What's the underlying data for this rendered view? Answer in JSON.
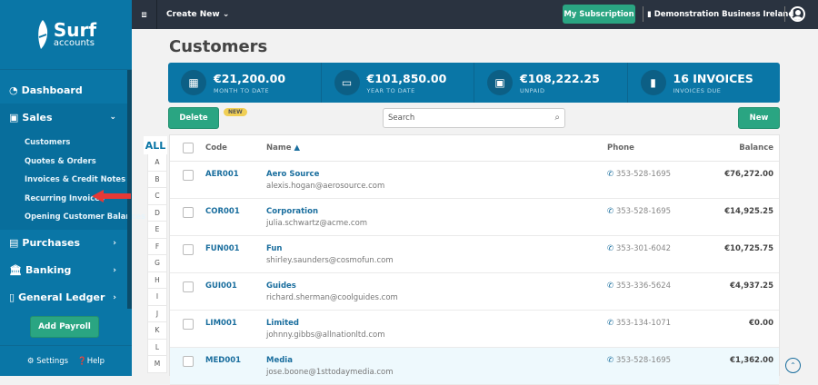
{
  "logo": {
    "word": "Surf",
    "sub": "accounts"
  },
  "sidebar": {
    "items": [
      {
        "label": "Dashboard",
        "icon": "dashboard-icon"
      },
      {
        "label": "Sales",
        "icon": "briefcase-icon",
        "expanded": true,
        "children": [
          "Customers",
          "Quotes & Orders",
          "Invoices & Credit Notes",
          "Recurring Invoices",
          "Opening Customer Balances"
        ]
      },
      {
        "label": "Purchases",
        "icon": "purchases-icon"
      },
      {
        "label": "Banking",
        "icon": "bank-icon"
      },
      {
        "label": "General Ledger",
        "icon": "ledger-icon"
      }
    ],
    "add_payroll": "Add Payroll",
    "settings": "Settings",
    "help": "Help"
  },
  "topbar": {
    "create_new": "Create New",
    "my_subscription": "My Subscription",
    "business": "Demonstration Business Ireland"
  },
  "page": {
    "title": "Customers"
  },
  "stats": [
    {
      "value": "€21,200.00",
      "label": "MONTH TO DATE"
    },
    {
      "value": "€101,850.00",
      "label": "YEAR TO DATE"
    },
    {
      "value": "€108,222.25",
      "label": "UNPAID"
    },
    {
      "value": "16 INVOICES",
      "label": "INVOICES DUE"
    }
  ],
  "toolbar": {
    "delete": "Delete",
    "new_badge": "NEW",
    "search_placeholder": "Search",
    "new": "New"
  },
  "alphabet": {
    "all": "ALL",
    "letters": [
      "A",
      "B",
      "C",
      "D",
      "E",
      "F",
      "G",
      "H",
      "I",
      "J",
      "K",
      "L",
      "M"
    ]
  },
  "table": {
    "headers": {
      "code": "Code",
      "name": "Name",
      "phone": "Phone",
      "balance": "Balance"
    },
    "rows": [
      {
        "code": "AER001",
        "name": "Aero Source",
        "email": "alexis.hogan@aerosource.com",
        "phone": "353-528-1695",
        "balance": "€76,272.00"
      },
      {
        "code": "COR001",
        "name": "Corporation",
        "email": "julia.schwartz@acme.com",
        "phone": "353-528-1695",
        "balance": "€14,925.25"
      },
      {
        "code": "FUN001",
        "name": "Fun",
        "email": "shirley.saunders@cosmofun.com",
        "phone": "353-301-6042",
        "balance": "€10,725.75"
      },
      {
        "code": "GUI001",
        "name": "Guides",
        "email": "richard.sherman@coolguides.com",
        "phone": "353-336-5624",
        "balance": "€4,937.25"
      },
      {
        "code": "LIM001",
        "name": "Limited",
        "email": "johnny.gibbs@allnationltd.com",
        "phone": "353-134-1071",
        "balance": "€0.00"
      },
      {
        "code": "MED001",
        "name": "Media",
        "email": "jose.boone@1sttodaymedia.com",
        "phone": "353-528-1695",
        "balance": "€1,362.00"
      }
    ]
  }
}
